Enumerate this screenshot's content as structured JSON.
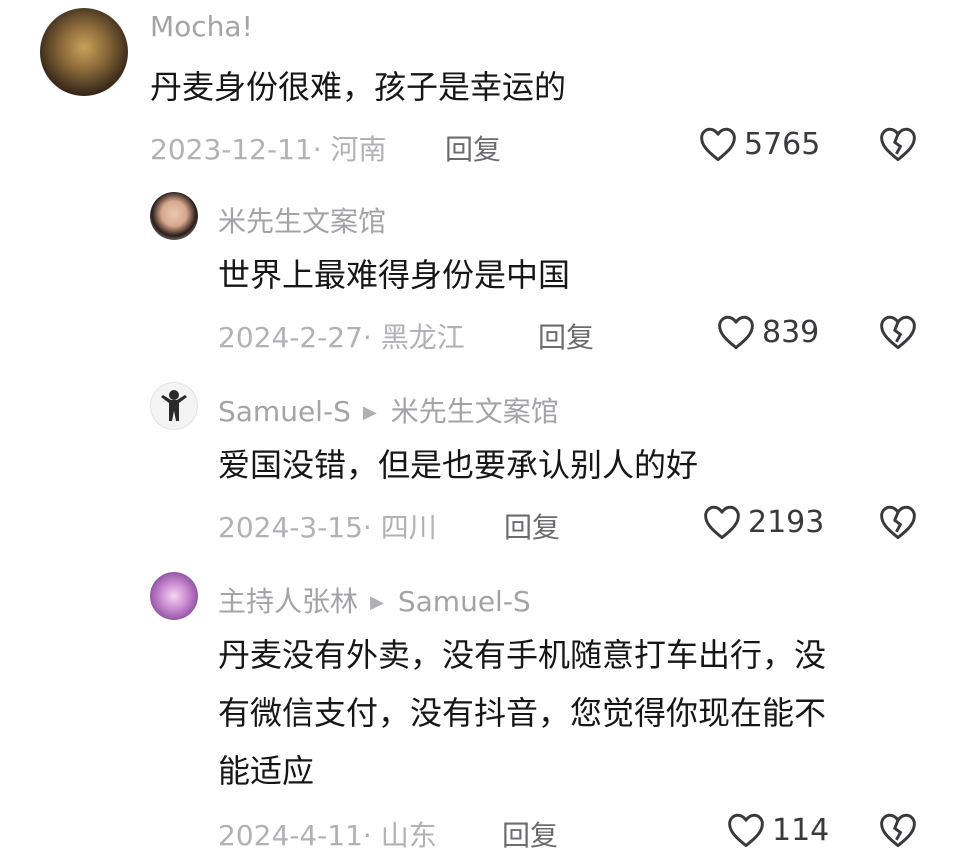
{
  "comments": [
    {
      "author": "Mocha!",
      "text": "丹麦身份很难，孩子是幸运的",
      "date_location": "2023-12-11· 河南",
      "reply_label": "回复",
      "likes": "5765"
    },
    {
      "author": "米先生文案馆",
      "text": "世界上最难得身份是中国",
      "date_location": "2024-2-27· 黑龙江",
      "reply_label": "回复",
      "likes": "839"
    },
    {
      "author": "Samuel-S",
      "reply_to": "米先生文案馆",
      "text": "爱国没错，但是也要承认别人的好",
      "date_location": "2024-3-15· 四川",
      "reply_label": "回复",
      "likes": "2193"
    },
    {
      "author": "主持人张林",
      "reply_to": "Samuel-S",
      "text_lines": [
        "丹麦没有外卖，没有手机随意打车出行，没",
        "有微信支付，没有抖音，您觉得你现在能不",
        "能适应"
      ],
      "date_location": "2024-4-11· 山东",
      "reply_label": "回复",
      "likes": "114"
    }
  ],
  "icons": {
    "like": "heart-outline-icon",
    "dislike": "broken-heart-icon",
    "reply_arrow": "triangle-right-icon"
  },
  "colors": {
    "text": "#161616",
    "muted": "#a4a4a8",
    "reply": "#6c6c70"
  }
}
